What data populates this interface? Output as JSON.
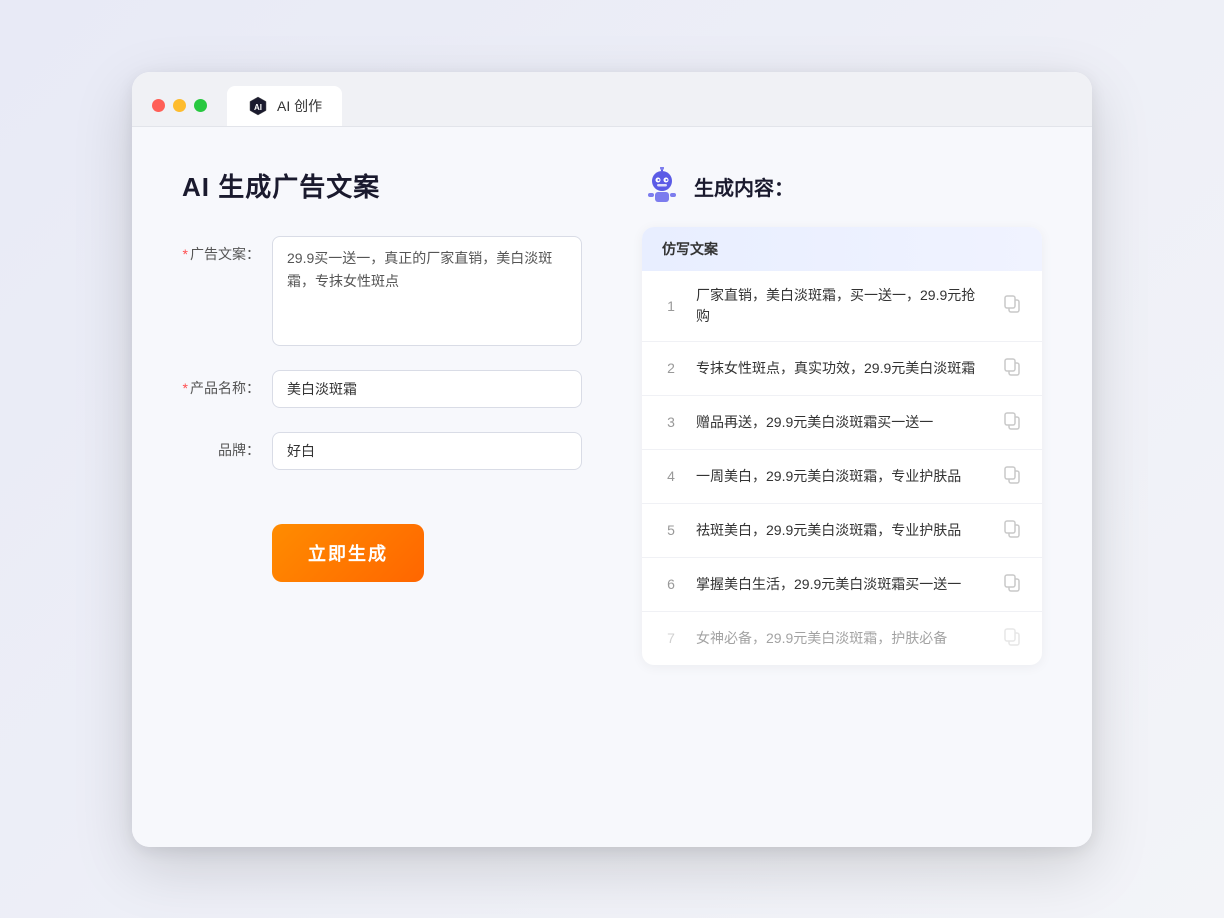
{
  "browser": {
    "tab_label": "AI 创作"
  },
  "page": {
    "title": "AI 生成广告文案",
    "form": {
      "ad_copy_label": "广告文案：",
      "ad_copy_required": "*",
      "ad_copy_value": "29.9买一送一，真正的厂家直销，美白淡斑霜，专抹女性斑点",
      "product_name_label": "产品名称：",
      "product_name_required": "*",
      "product_name_value": "美白淡斑霜",
      "brand_label": "品牌：",
      "brand_value": "好白",
      "generate_button": "立即生成"
    },
    "result_panel": {
      "title": "生成内容：",
      "table_header": "仿写文案",
      "items": [
        {
          "num": "1",
          "text": "厂家直销，美白淡斑霜，买一送一，29.9元抢购",
          "faded": false
        },
        {
          "num": "2",
          "text": "专抹女性斑点，真实功效，29.9元美白淡斑霜",
          "faded": false
        },
        {
          "num": "3",
          "text": "赠品再送，29.9元美白淡斑霜买一送一",
          "faded": false
        },
        {
          "num": "4",
          "text": "一周美白，29.9元美白淡斑霜，专业护肤品",
          "faded": false
        },
        {
          "num": "5",
          "text": "祛斑美白，29.9元美白淡斑霜，专业护肤品",
          "faded": false
        },
        {
          "num": "6",
          "text": "掌握美白生活，29.9元美白淡斑霜买一送一",
          "faded": false
        },
        {
          "num": "7",
          "text": "女神必备，29.9元美白淡斑霜，护肤必备",
          "faded": true
        }
      ]
    }
  }
}
